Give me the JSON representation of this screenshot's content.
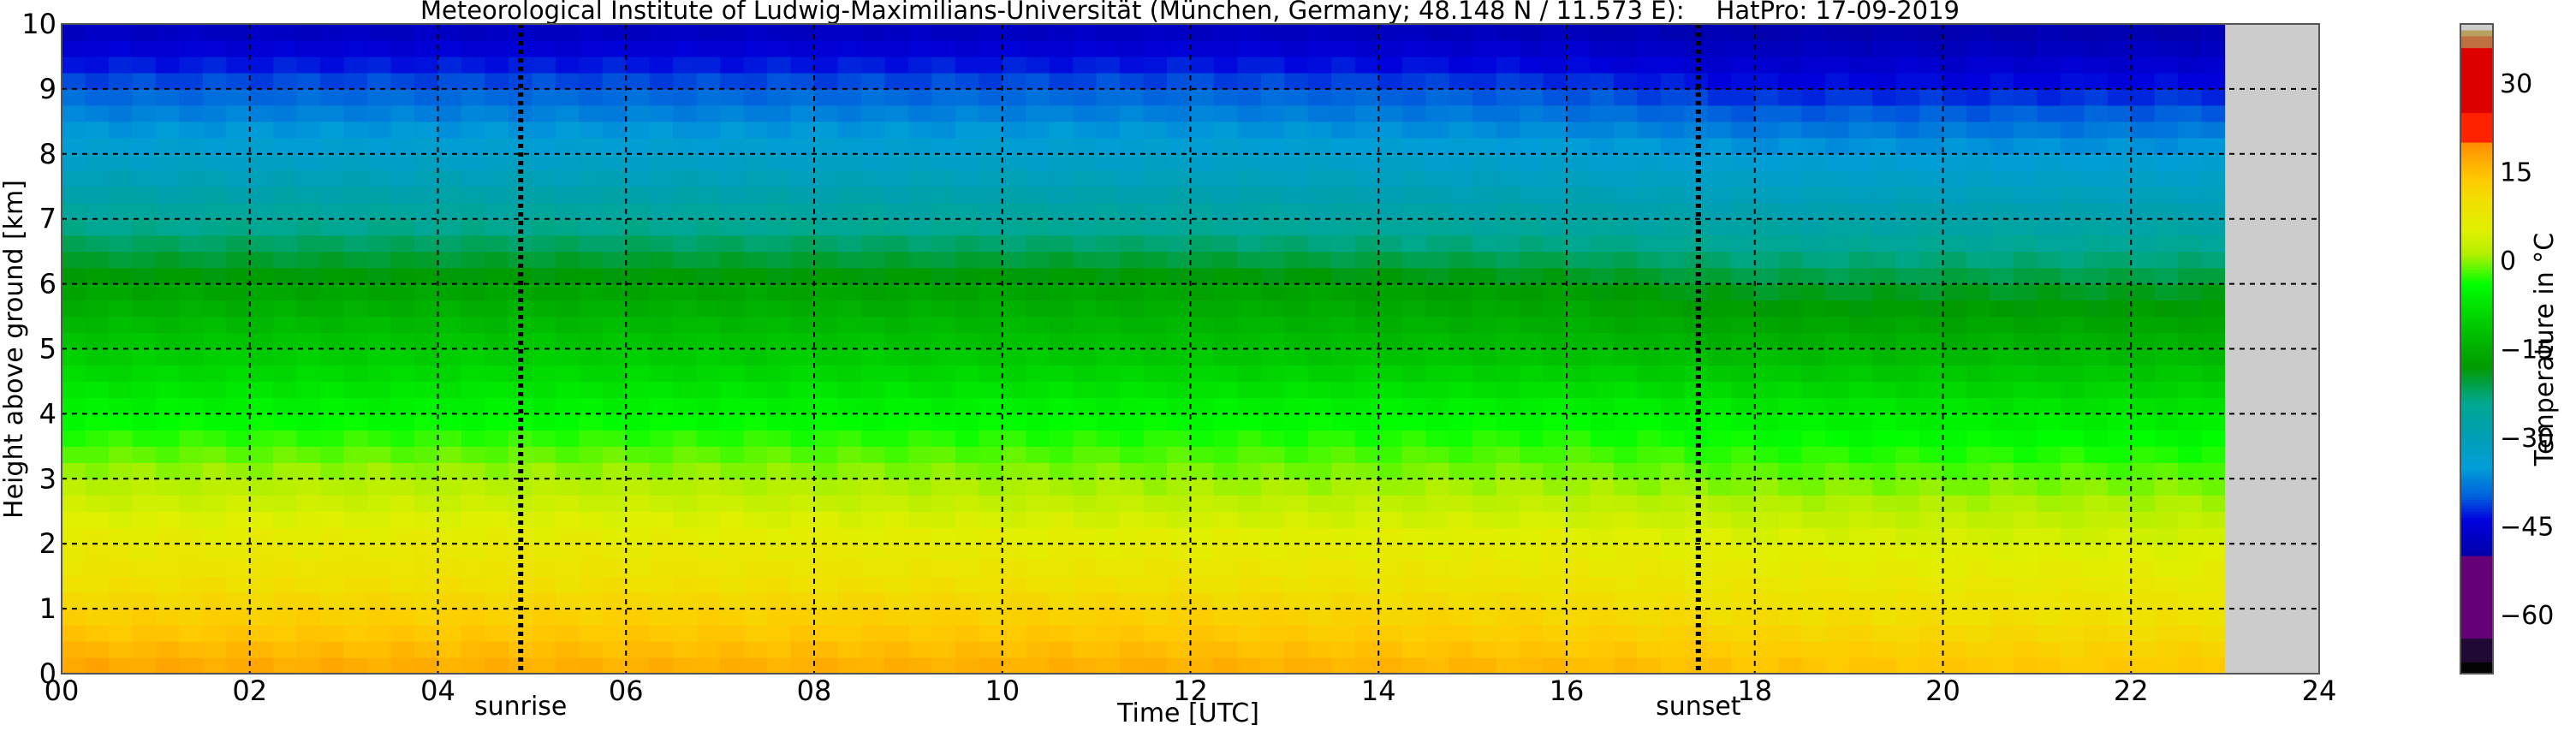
{
  "chart_data": {
    "type": "heatmap",
    "title": "Meteorological Institute of Ludwig-Maximilians-Universität (München, Germany; 48.148 N / 11.573 E):    HatPro: 17-09-2019",
    "xlabel": "Time [UTC]",
    "ylabel": "Height above ground [km]",
    "xlim": [
      0,
      24
    ],
    "ylim": [
      0,
      10
    ],
    "xticks": [
      "00",
      "02",
      "04",
      "06",
      "08",
      "10",
      "12",
      "14",
      "16",
      "18",
      "20",
      "22",
      "24"
    ],
    "yticks": [
      "0",
      "1",
      "2",
      "3",
      "4",
      "5",
      "6",
      "7",
      "8",
      "9",
      "10"
    ],
    "grid": true,
    "data_end_hour": 23,
    "heights_km": [
      0,
      1,
      2,
      3,
      4,
      5,
      6,
      7,
      8,
      9,
      10
    ],
    "profiles": [
      {
        "time": 0,
        "temps": [
          18,
          12,
          7,
          1,
          -5,
          -11,
          -17,
          -25,
          -33,
          -40,
          -48
        ]
      },
      {
        "time": 5,
        "temps": [
          17,
          12,
          7,
          1,
          -5,
          -11,
          -17,
          -25,
          -33,
          -40,
          -48
        ]
      },
      {
        "time": 12,
        "temps": [
          17,
          12,
          6,
          0,
          -5,
          -12,
          -17,
          -26,
          -33,
          -40,
          -48
        ]
      },
      {
        "time": 16,
        "temps": [
          16,
          11,
          6,
          0,
          -5,
          -13,
          -18,
          -27,
          -34,
          -41,
          -49
        ]
      },
      {
        "time": 18,
        "temps": [
          15,
          10,
          5,
          -1,
          -6,
          -14,
          -20,
          -28,
          -35,
          -43,
          -50
        ]
      },
      {
        "time": 23,
        "temps": [
          14,
          9,
          4,
          -1,
          -7,
          -14,
          -20,
          -28,
          -35,
          -43,
          -50
        ]
      }
    ],
    "annotations": [
      {
        "label": "sunrise",
        "time": 4.88
      },
      {
        "label": "sunset",
        "time": 17.4
      }
    ],
    "colorbar": {
      "label": "Temperature in °C",
      "range": [
        -70,
        40
      ],
      "ticks": [
        "30",
        "15",
        "0",
        "−15",
        "−30",
        "−45",
        "−60"
      ],
      "tick_values": [
        30,
        15,
        0,
        -15,
        -30,
        -45,
        -60
      ],
      "stops": [
        [
          -70,
          "#050505"
        ],
        [
          -68,
          "#050505"
        ],
        [
          -67.9,
          "#200a35"
        ],
        [
          -64,
          "#200a35"
        ],
        [
          -63.9,
          "#660077"
        ],
        [
          -50,
          "#660077"
        ],
        [
          -49.9,
          "#0000aa"
        ],
        [
          -44,
          "#0000dd"
        ],
        [
          -40,
          "#0060dd"
        ],
        [
          -35,
          "#009ed8"
        ],
        [
          -29,
          "#00a0b0"
        ],
        [
          -24,
          "#00a890"
        ],
        [
          -18,
          "#009a00"
        ],
        [
          -10,
          "#00d000"
        ],
        [
          -4,
          "#00ff00"
        ],
        [
          1,
          "#b0f000"
        ],
        [
          5,
          "#e0f000"
        ],
        [
          10,
          "#f0e000"
        ],
        [
          14,
          "#ffc800"
        ],
        [
          20,
          "#ff8c00"
        ],
        [
          20.1,
          "#ff2200"
        ],
        [
          25,
          "#ff2200"
        ],
        [
          25.1,
          "#dd0000"
        ],
        [
          36,
          "#dd0000"
        ],
        [
          36.1,
          "#c07040"
        ],
        [
          38,
          "#c07040"
        ],
        [
          38.1,
          "#b8a060"
        ],
        [
          39,
          "#b8a060"
        ],
        [
          39.1,
          "#cccccc"
        ],
        [
          40,
          "#cccccc"
        ]
      ],
      "nodata_color": "#cccccc"
    }
  }
}
